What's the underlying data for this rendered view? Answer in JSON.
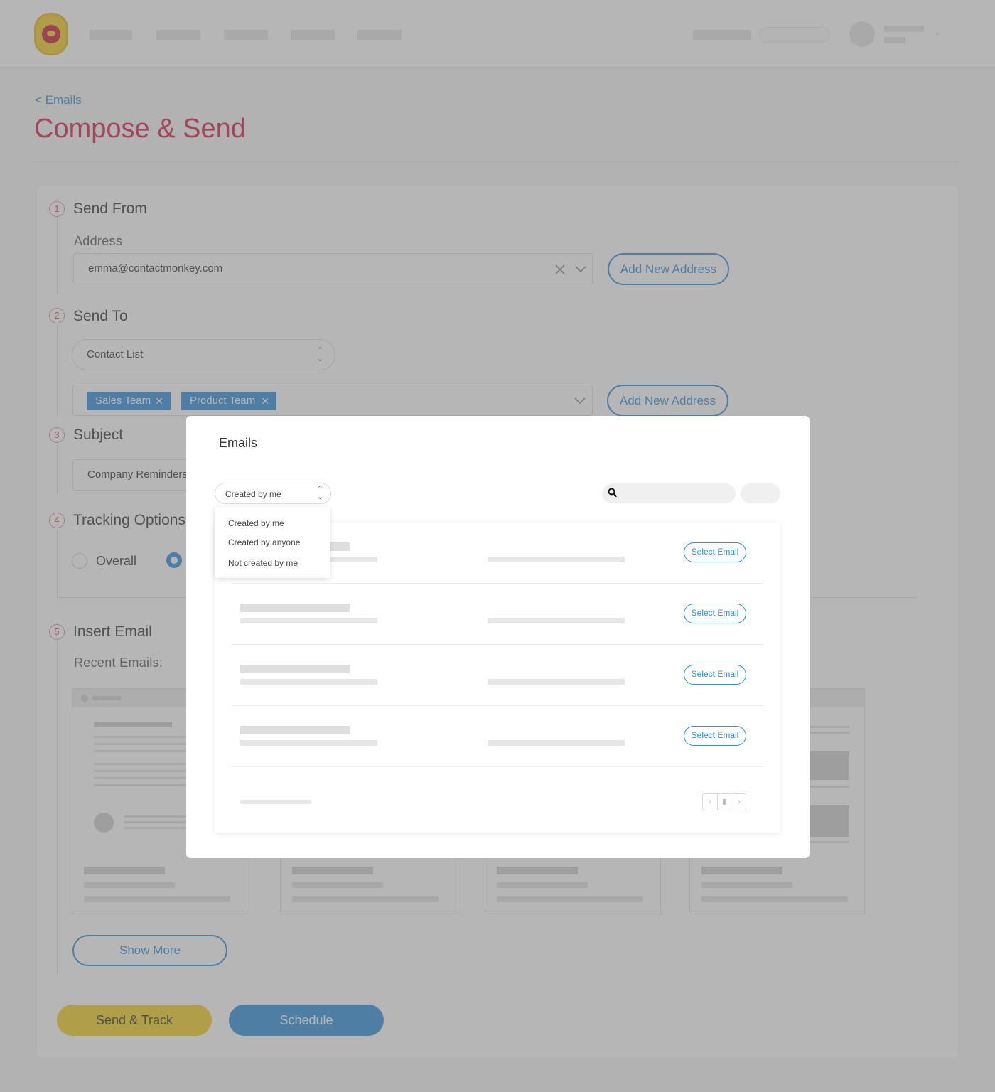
{
  "breadcrumb": {
    "label": "< Emails"
  },
  "page": {
    "title": "Compose & Send"
  },
  "steps": [
    {
      "num": "1",
      "title": "Send From"
    },
    {
      "num": "2",
      "title": "Send To"
    },
    {
      "num": "3",
      "title": "Subject"
    },
    {
      "num": "4",
      "title": "Tracking Options"
    },
    {
      "num": "5",
      "title": "Insert Email"
    }
  ],
  "send_from": {
    "label": "Address",
    "value": "emma@contactmonkey.com",
    "add_button": "Add New Address"
  },
  "send_to": {
    "list_type": "Contact List",
    "chips": [
      "Sales Team",
      "Product Team"
    ],
    "add_button": "Add New Address"
  },
  "subject": {
    "value": "Company Reminders"
  },
  "tracking": {
    "option_overall": "Overall"
  },
  "insert_email": {
    "label": "Recent Emails:",
    "show_more": "Show More"
  },
  "actions": {
    "send_track": "Send & Track",
    "schedule": "Schedule"
  },
  "modal": {
    "title": "Emails",
    "filter_selected": "Created by me",
    "filter_options": [
      "Created by me",
      "Created by anyone",
      "Not created by me"
    ],
    "select_label": "Select Email"
  },
  "colors": {
    "brand_red": "#d81e49",
    "accent_blue": "#2f8fd8",
    "send_yellow": "#f2cf22"
  },
  "icons": {
    "clear": "close-icon",
    "dropdown": "chevron-down-icon",
    "search": "search-icon",
    "sort": "up-down-arrows-icon"
  }
}
